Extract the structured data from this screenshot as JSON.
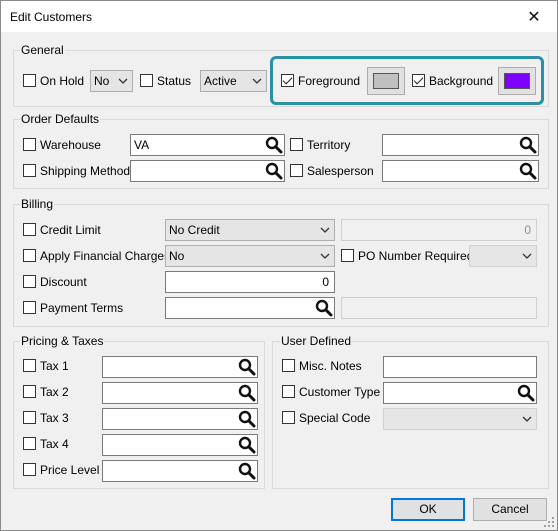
{
  "window": {
    "title": "Edit Customers",
    "close_glyph": "✕"
  },
  "general": {
    "label": "General",
    "on_hold": {
      "label": "On Hold",
      "checked": false,
      "value": "No"
    },
    "status": {
      "label": "Status",
      "checked": false,
      "value": "Active"
    },
    "foreground": {
      "label": "Foreground",
      "checked": true,
      "color": "#c0c0c0"
    },
    "background": {
      "label": "Background",
      "checked": true,
      "color": "#8000ff"
    }
  },
  "order_defaults": {
    "label": "Order Defaults",
    "warehouse": {
      "label": "Warehouse",
      "checked": false,
      "value": "VA"
    },
    "territory": {
      "label": "Territory",
      "checked": false,
      "value": ""
    },
    "shipping_method": {
      "label": "Shipping Method",
      "checked": false,
      "value": ""
    },
    "salesperson": {
      "label": "Salesperson",
      "checked": false,
      "value": ""
    }
  },
  "billing": {
    "label": "Billing",
    "credit_limit": {
      "label": "Credit Limit",
      "checked": false,
      "value": "No Credit",
      "amount": "0"
    },
    "apply_financial_charges": {
      "label": "Apply Financial Charges",
      "checked": false,
      "value": "No"
    },
    "po_number_required": {
      "label": "PO Number Required",
      "checked": false,
      "value": ""
    },
    "discount": {
      "label": "Discount",
      "checked": false,
      "value": "0"
    },
    "payment_terms": {
      "label": "Payment Terms",
      "checked": false,
      "value": ""
    }
  },
  "pricing_taxes": {
    "label": "Pricing & Taxes",
    "tax1": {
      "label": "Tax 1",
      "value": ""
    },
    "tax2": {
      "label": "Tax 2",
      "value": ""
    },
    "tax3": {
      "label": "Tax 3",
      "value": ""
    },
    "tax4": {
      "label": "Tax 4",
      "value": ""
    },
    "price_level": {
      "label": "Price Level",
      "value": ""
    }
  },
  "user_defined": {
    "label": "User Defined",
    "misc_notes": {
      "label": "Misc. Notes",
      "value": ""
    },
    "customer_type": {
      "label": "Customer Type",
      "value": ""
    },
    "special_code": {
      "label": "Special Code",
      "value": ""
    }
  },
  "buttons": {
    "ok": "OK",
    "cancel": "Cancel"
  },
  "colors": {
    "highlight": "#2a8fa8",
    "default_button_border": "#0078d7"
  },
  "icons": [
    "close-icon",
    "chevron-down-icon",
    "search-icon",
    "checkmark-icon",
    "resize-grip-icon"
  ]
}
